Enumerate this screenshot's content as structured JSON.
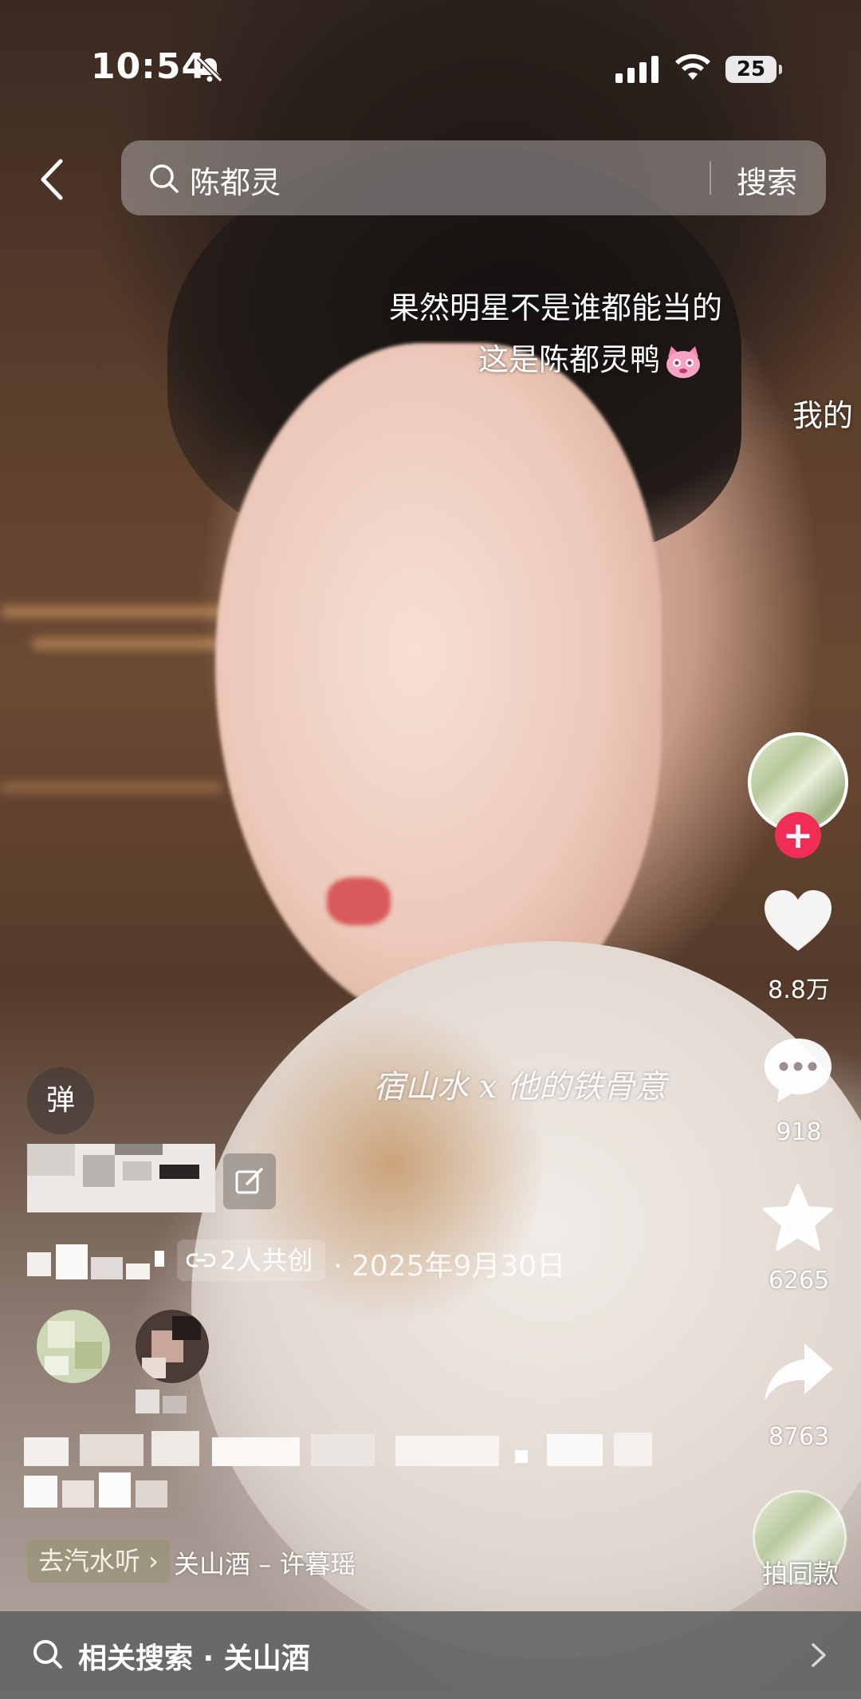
{
  "status_bar": {
    "time": "10:54",
    "battery": "25",
    "icons": [
      "bell-slash-icon",
      "signal-icon",
      "wifi-icon",
      "battery-icon"
    ]
  },
  "search": {
    "query": "陈都灵",
    "button_label": "搜索"
  },
  "video": {
    "caption_line1": "果然明星不是谁都能当的",
    "caption_line2": "这是陈都灵鸭",
    "caption_partial": "我的",
    "watermark": "宿山水 x 他的铁骨意"
  },
  "actions": {
    "like_count": "8.8万",
    "comment_count": "918",
    "favorite_count": "6265",
    "share_count": "8763",
    "same_style_label": "拍同款",
    "follow_symbol": "+"
  },
  "info": {
    "danmaku_label": "弹",
    "cocreate_label": "2人共创",
    "date": "· 2025年9月30日",
    "music_tag": "去汽水听 ›",
    "music_title": "关山酒 – 许暮瑶"
  },
  "related": {
    "text": "相关搜索 · 关山酒"
  },
  "colors": {
    "accent_red": "#f02d57",
    "overlay_gray": "#5a5a5c"
  }
}
